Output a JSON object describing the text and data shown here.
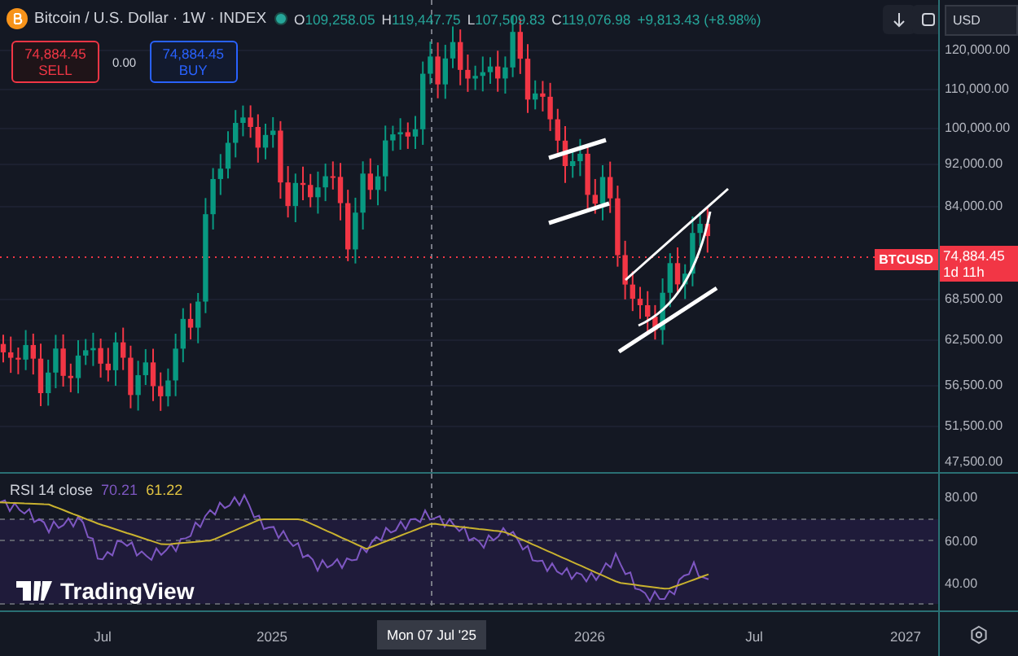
{
  "header": {
    "symbol": "Bitcoin / U.S. Dollar · 1W · INDEX",
    "ohlc": [
      {
        "label": "O",
        "value": "109,258.05"
      },
      {
        "label": "H",
        "value": "119,447.75"
      },
      {
        "label": "L",
        "value": "107,509.83"
      },
      {
        "label": "C",
        "value": "119,076.98"
      }
    ],
    "change": "+9,813.43 (+8.98%)"
  },
  "trade": {
    "sell_price": "74,884.45",
    "sell_label": "SELL",
    "spread": "0.00",
    "buy_price": "74,884.45",
    "buy_label": "BUY"
  },
  "currency": "USD",
  "price_axis": [
    "120,000.00",
    "110,000.00",
    "100,000.00",
    "92,000.00",
    "84,000.00",
    "68,500.00",
    "62,500.00",
    "56,500.00",
    "51,500.00",
    "47,500.00"
  ],
  "price_tag": {
    "symbol": "BTCUSD",
    "price": "74,884.45",
    "countdown": "1d 11h"
  },
  "rsi": {
    "label": "RSI 14 close",
    "value": "70.21",
    "ma_value": "61.22",
    "axis": [
      "80.00",
      "60.00",
      "40.00"
    ]
  },
  "logo": "TradingView",
  "time_axis": [
    {
      "label": "Jul"
    },
    {
      "label": "2025"
    },
    {
      "label": "2026"
    },
    {
      "label": "Jul"
    },
    {
      "label": "2027"
    }
  ],
  "crosshair_label": "Mon 07 Jul '25"
}
